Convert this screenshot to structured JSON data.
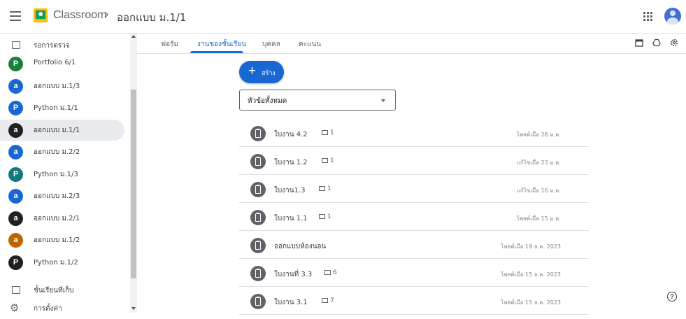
{
  "header": {
    "brand": "Classroom",
    "separator": "›",
    "breadcrumb": "ออกแบบ ม.1/1"
  },
  "sidebar": {
    "todo_label": "รอการตรวจ",
    "classes": [
      {
        "letter": "P",
        "name": "Portfolio 6/1",
        "color": "#188038"
      },
      {
        "letter": "a",
        "name": "ออกแบบ ม.1/3",
        "color": "#1967d2"
      },
      {
        "letter": "P",
        "name": "Python ม.1/1",
        "color": "#1967d2"
      },
      {
        "letter": "a",
        "name": "ออกแบบ ม.1/1",
        "color": "#202124"
      },
      {
        "letter": "a",
        "name": "ออกแบบ ม.2/2",
        "color": "#1967d2"
      },
      {
        "letter": "P",
        "name": "Python ม.1/3",
        "color": "#12787a"
      },
      {
        "letter": "a",
        "name": "ออกแบบ ม.2/3",
        "color": "#1967d2"
      },
      {
        "letter": "a",
        "name": "ออกแบบ ม.2/1",
        "color": "#202124"
      },
      {
        "letter": "a",
        "name": "ออกแบบ ม.1/2",
        "color": "#c26401"
      },
      {
        "letter": "P",
        "name": "Python ม.1/2",
        "color": "#202124"
      }
    ],
    "archived_label": "ชั้นเรียนที่เก็บ",
    "settings_label": "การตั้งค่า"
  },
  "tabs": {
    "stream": "ฟอรัม",
    "classwork": "งานของชั้นเรียน",
    "people": "บุคคล",
    "grades": "คะแนน"
  },
  "main": {
    "create_label": "สร้าง",
    "topic_filter": "หัวข้อทั้งหมด",
    "items": [
      {
        "title": "ใบงาน 4.2",
        "comments": "1",
        "date": "โพสต์เมื่อ 28 ม.ค."
      },
      {
        "title": "ใบงาน 1.2",
        "comments": "1",
        "date": "แก้ไขเมื่อ 23 ม.ค."
      },
      {
        "title": "ใบงาน1.3",
        "comments": "1",
        "date": "แก้ไขเมื่อ 16 ม.ค."
      },
      {
        "title": "ใบงาน 1.1",
        "comments": "1",
        "date": "โพสต์เมื่อ 15 ม.ค."
      },
      {
        "title": "ออกแบบห้องนอน",
        "comments": "",
        "date": "โพสต์เมื่อ 19 ธ.ค. 2023"
      },
      {
        "title": "ใบงานที่ 3.3",
        "comments": "6",
        "date": "โพสต์เมื่อ 15 ธ.ค. 2023"
      },
      {
        "title": "ใบงาน 3.1",
        "comments": "7",
        "date": "โพสต์เมื่อ 15 ธ.ค. 2023"
      }
    ]
  },
  "help": "?"
}
